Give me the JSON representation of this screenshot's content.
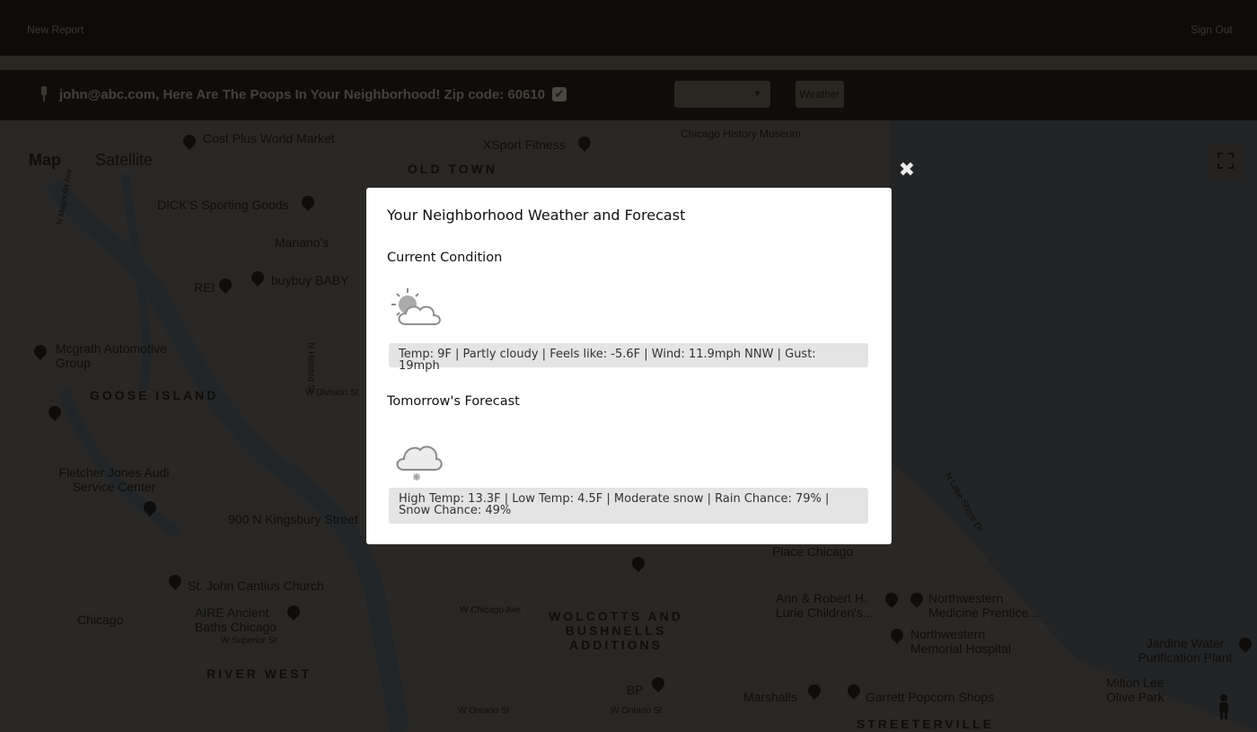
{
  "navbar": {
    "left_link": "New Report",
    "right_link": "Sign Out"
  },
  "toolbar": {
    "greeting": "john@abc.com, Here Are The Poops In Your Neighborhood! Zip code: 60610",
    "checkbox_checked": true,
    "weather_button": "Weather"
  },
  "map": {
    "type_map": "Map",
    "type_satellite": "Satellite",
    "places": [
      "Cost Plus World Market",
      "XSport Fitness",
      "Chicago History Museum",
      "DICK'S Sporting Goods",
      "Mariano's",
      "buybuy BABY",
      "REI",
      "Mcgrath Automotive Group",
      "Fletcher Jones Audi Service Center",
      "900 N Kingsbury Street",
      "St. John Cantius Church",
      "AIRE Ancient Baths Chicago",
      "Chicago",
      "BP",
      "Marshalls",
      "Garrett Popcorn Shops",
      "Ann & Robert H. Lurie Children's...",
      "Northwestern Medicine Prentice...",
      "Northwestern Memorial Hospital",
      "Jardine Water Purification Plant",
      "Milton Lee Olive Park",
      "Place Chicago"
    ],
    "districts": [
      "OLD TOWN",
      "GOOSE ISLAND",
      "WOLCOTTS AND BUSHNELLS ADDITIONS",
      "RIVER WEST",
      "STREETERVILLE"
    ]
  },
  "modal": {
    "title": "Your Neighborhood Weather and Forecast",
    "current_heading": "Current Condition",
    "current_icon": "partly-cloudy-icon",
    "current_text": "Temp: 9F | Partly cloudy | Feels like: -5.6F | Wind: 11.9mph NNW | Gust: 19mph",
    "forecast_heading": "Tomorrow's Forecast",
    "forecast_icon": "snow-cloud-icon",
    "forecast_text": "High Temp: 13.3F | Low Temp: 4.5F | Moderate snow | Rain Chance: 79% | Snow Chance: 49%",
    "close_icon": "close-icon"
  }
}
